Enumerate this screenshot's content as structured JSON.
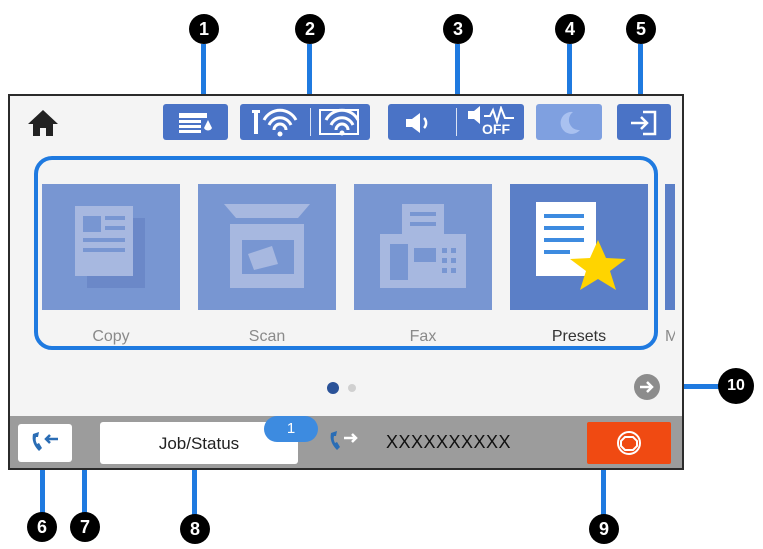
{
  "header": {
    "home_icon": "home-icon",
    "status_icons": [
      {
        "name": "ink-supply-icon"
      },
      {
        "name": "wifi-status-icon"
      },
      {
        "name": "wifi-direct-icon"
      },
      {
        "name": "sound-on-icon"
      },
      {
        "name": "fax-sound-off-icon",
        "text": "OFF"
      },
      {
        "name": "sleep-moon-icon"
      },
      {
        "name": "login-icon"
      }
    ]
  },
  "menu": {
    "tiles": [
      {
        "label": "Copy"
      },
      {
        "label": "Scan"
      },
      {
        "label": "Fax"
      },
      {
        "label": "Presets"
      },
      {
        "label": "M"
      }
    ],
    "page_indicator": {
      "current": 1,
      "total": 2
    }
  },
  "footer": {
    "job_status_label": "Job/Status",
    "job_count": "1",
    "fax_number": "XXXXXXXXXX"
  },
  "callouts": [
    "1",
    "2",
    "3",
    "4",
    "5",
    "6",
    "7",
    "8",
    "9",
    "10"
  ],
  "colors": {
    "accent": "#4a73c6",
    "stop": "#f04a12",
    "callout_line": "#1f7ae0"
  }
}
